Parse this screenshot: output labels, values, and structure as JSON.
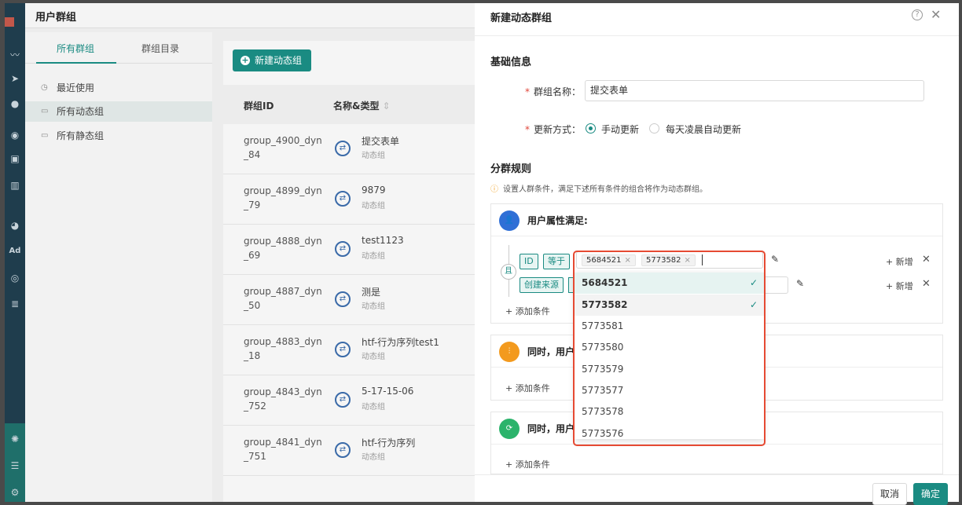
{
  "app": {
    "title": "用户群组",
    "tabs": [
      "所有群组",
      "群组目录"
    ],
    "nav": [
      "最近使用",
      "所有动态组",
      "所有静态组"
    ],
    "new_button": "新建动态组",
    "columns": [
      "群组ID",
      "名称&类型"
    ],
    "rows": [
      {
        "id": "group_4900_dyn_84",
        "name": "提交表单",
        "type": "动态组"
      },
      {
        "id": "group_4899_dyn_79",
        "name": "9879",
        "type": "动态组"
      },
      {
        "id": "group_4888_dyn_69",
        "name": "test1123",
        "type": "动态组"
      },
      {
        "id": "group_4887_dyn_50",
        "name": "测是",
        "type": "动态组"
      },
      {
        "id": "group_4883_dyn_18",
        "name": "htf-行为序列test1",
        "type": "动态组"
      },
      {
        "id": "group_4843_dyn_752",
        "name": "5-17-15-06",
        "type": "动态组"
      },
      {
        "id": "group_4841_dyn_751",
        "name": "htf-行为序列",
        "type": "动态组"
      }
    ],
    "rail_labels": {
      "ad": "Ad"
    }
  },
  "drawer": {
    "title": "新建动态群组",
    "basic_title": "基础信息",
    "name_label": "群组名称：",
    "name_value": "提交表单",
    "update_label": "更新方式：",
    "update_options": [
      "手动更新",
      "每天凌晨自动更新"
    ],
    "rules_title": "分群规则",
    "rules_hint": "设置人群条件，满足下述所有条件的组合将作为动态群组。",
    "cards": [
      {
        "title": "用户属性满足:"
      },
      {
        "title": "同时，用户"
      },
      {
        "title": "同时，用户"
      }
    ],
    "and_label": "且",
    "cond1": {
      "field": "ID",
      "op": "等于",
      "values": [
        "5684521",
        "5773582"
      ]
    },
    "cond2": {
      "field": "创建来源"
    },
    "add_condition": "添加条件",
    "row_add": "新增",
    "dropdown_options": [
      "5684521",
      "5773582",
      "5773581",
      "5773580",
      "5773579",
      "5773577",
      "5773578",
      "5773576"
    ],
    "cancel": "取消",
    "ok": "确定"
  },
  "colors": {
    "accent": "#1a8b82",
    "highlight": "#e64a33",
    "blue": "#2f6fd6",
    "orange": "#f39a1e",
    "green": "#2bb36b"
  }
}
